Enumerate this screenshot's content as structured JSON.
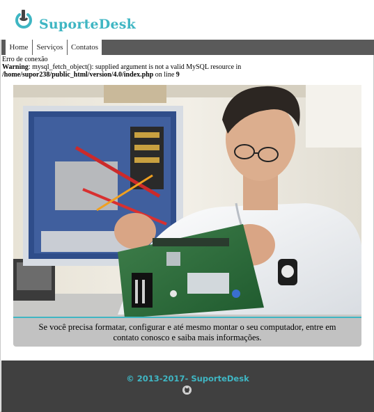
{
  "header": {
    "brand": "SuporteDesk",
    "logo_icon": "power-button-icon",
    "brand_color": "#3fb6c3"
  },
  "nav": {
    "items": [
      {
        "label": "Home"
      },
      {
        "label": "Serviços"
      },
      {
        "label": "Contatos"
      }
    ]
  },
  "errors": {
    "line1": "Erro de conexão",
    "warning_label": "Warning",
    "warning_text": ": mysql_fetch_object(): supplied argument is not a valid MySQL resource in",
    "path": "/home/supor238/public_html/version/4.0/index.php",
    "on_line_text": " on line ",
    "line_number": "9"
  },
  "hero": {
    "caption": "Se você precisa formatar, configurar e até mesmo montar o seu computador, entre em contato conosco e saiba mais informações."
  },
  "footer": {
    "copyright": "© 2013-2017- SuporteDesk",
    "social_icon": "github-icon"
  }
}
